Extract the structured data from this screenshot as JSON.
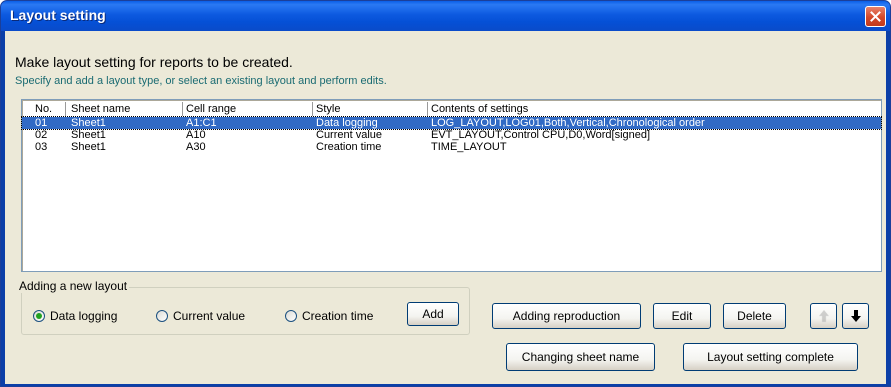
{
  "window": {
    "title": "Layout setting",
    "close_icon": "close-icon"
  },
  "intro": {
    "heading": "Make layout setting for reports to be created.",
    "subheading": "Specify and add a layout type, or select an existing layout and perform edits."
  },
  "table": {
    "columns": [
      "No.",
      "Sheet name",
      "Cell range",
      "Style",
      "Contents of settings"
    ],
    "rows": [
      {
        "no": "01",
        "sheet": "Sheet1",
        "range": "A1:C1",
        "style": "Data logging",
        "contents": "LOG_LAYOUT,LOG01,Both,Vertical,Chronological order",
        "selected": true
      },
      {
        "no": "02",
        "sheet": "Sheet1",
        "range": "A10",
        "style": "Current value",
        "contents": "EVT_LAYOUT,Control CPU,D0,Word[signed]",
        "selected": false
      },
      {
        "no": "03",
        "sheet": "Sheet1",
        "range": "A30",
        "style": "Creation time",
        "contents": "TIME_LAYOUT",
        "selected": false
      }
    ]
  },
  "new_layout": {
    "group_label": "Adding a new layout",
    "options": [
      {
        "label": "Data logging",
        "checked": true
      },
      {
        "label": "Current value",
        "checked": false
      },
      {
        "label": "Creation time",
        "checked": false
      }
    ],
    "add_label": "Add"
  },
  "actions": {
    "adding_reproduction": "Adding reproduction",
    "edit": "Edit",
    "delete": "Delete",
    "move_up_icon": "arrow-up-icon",
    "move_down_icon": "arrow-down-icon",
    "changing_sheet_name": "Changing sheet name",
    "layout_setting_complete": "Layout setting complete"
  },
  "colors": {
    "title_bar": "#0a5fe8",
    "selection": "#316ac5",
    "dialog_bg": "#ece9d8",
    "subheading": "#1a6b72",
    "close_button": "#d3482a"
  }
}
